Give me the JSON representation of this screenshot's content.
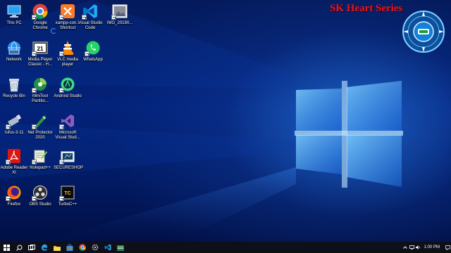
{
  "desktop": {
    "icons": [
      {
        "label": "This PC",
        "icon": "this-pc-icon"
      },
      {
        "label": "Google Chrome",
        "icon": "chrome-icon"
      },
      {
        "label": "xampp-con... Shortcut",
        "icon": "xampp-icon"
      },
      {
        "label": "Visual Studio Code",
        "icon": "vscode-icon"
      },
      {
        "label": "IMG_20190...",
        "icon": "image-file-icon"
      },
      {
        "label": "Network",
        "icon": "network-icon"
      },
      {
        "label": "Media Player Classic - H...",
        "icon": "media-player-classic-icon"
      },
      {
        "label": "VLC media player",
        "icon": "vlc-icon"
      },
      {
        "label": "WhatsApp",
        "icon": "whatsapp-icon"
      },
      {
        "label": "Recycle Bin",
        "icon": "recycle-bin-icon"
      },
      {
        "label": "MiniTool Partitio...",
        "icon": "minitool-icon"
      },
      {
        "label": "Android Studio",
        "icon": "android-studio-icon"
      },
      {
        "label": "rufus-3-11",
        "icon": "rufus-icon"
      },
      {
        "label": "Net Protector 2020",
        "icon": "net-protector-icon"
      },
      {
        "label": "Microsoft Visual Stud...",
        "icon": "visual-studio-icon"
      },
      {
        "label": "Adobe Reader XI",
        "icon": "adobe-reader-icon"
      },
      {
        "label": "Notepad++",
        "icon": "notepad-plus-plus-icon"
      },
      {
        "label": "SECURESHOP",
        "icon": "secureshop-icon"
      },
      {
        "label": "Firefox",
        "icon": "firefox-icon"
      },
      {
        "label": "OBS Studio",
        "icon": "obs-icon"
      },
      {
        "label": "TurboC++",
        "icon": "turbo-cpp-icon"
      }
    ],
    "watermark": "SK Heart Series"
  },
  "taskbar": {
    "apps": [
      "file-explorer-icon",
      "store-icon",
      "chrome-icon",
      "settings-icon",
      "vscode-icon",
      "file-manager-icon"
    ],
    "clock": "1:00 PM"
  },
  "colors": {
    "accent": "#2f9bff",
    "taskbar": "#0d0f19",
    "brand": "#e8141c"
  }
}
